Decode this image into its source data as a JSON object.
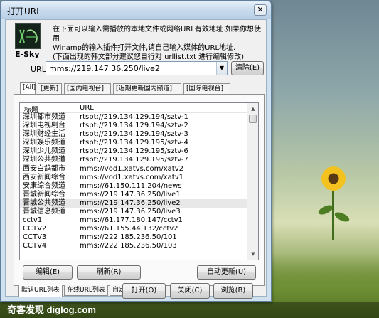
{
  "window": {
    "title": "打开URL",
    "close_glyph": "✕"
  },
  "logo": {
    "label": "E-Sky"
  },
  "intro": {
    "line1": "在下面可以输入需播放的本地文件或网络URL有效地址.如果你想使用",
    "line2": "Winamp的输入插件打开文件,请自己输入媒体的URL地址.",
    "line3": "(下面出现的韩文部分建议您自行对 urllist.txt 进行编辑修改)"
  },
  "url_field": {
    "label": "URL:",
    "value": "mms://219.147.36.250/live2",
    "clear_label": "清除(E)"
  },
  "tabs": [
    "[All]",
    "[更新]",
    "[国内电视台]",
    "[近期更新国内频道]",
    "[国际电视台]"
  ],
  "list": {
    "headers": {
      "title": "标题",
      "url": "URL"
    },
    "rows": [
      {
        "title": "深圳都市频道",
        "url": "rtspt://219.134.129.194/sztv-1"
      },
      {
        "title": "深圳电视剧台",
        "url": "rtspt://219.134.129.194/sztv-2"
      },
      {
        "title": "深圳财经生活",
        "url": "rtspt://219.134.129.194/sztv-3"
      },
      {
        "title": "深圳娱乐频道",
        "url": "rtspt://219.134.129.195/sztv-4"
      },
      {
        "title": "深圳少儿频道",
        "url": "rtspt://219.134.129.195/sztv-6"
      },
      {
        "title": "深圳公共频道",
        "url": "rtspt://219.134.129.195/sztv-7"
      },
      {
        "title": "西安白鸽都市",
        "url": "mms://vod1.xatvs.com/xatv2"
      },
      {
        "title": "西安新闻综合",
        "url": "mms://vod1.xatvs.com/xatv1"
      },
      {
        "title": "安康综合频道",
        "url": "mms://61.150.111.204/news"
      },
      {
        "title": "晋城新闻综合",
        "url": "mms://219.147.36.250/live1"
      },
      {
        "title": "晋城公共频道",
        "url": "mms://219.147.36.250/live2"
      },
      {
        "title": "晋城信息频道",
        "url": "mms://219.147.36.250/live3"
      },
      {
        "title": "cctv1",
        "url": "mms://61.177.180.147/cctv1"
      },
      {
        "title": "CCTV2",
        "url": "mms://61.155.44.132/cctv2"
      },
      {
        "title": "CCTV3",
        "url": "mms://222.185.236.50/101"
      },
      {
        "title": "CCTV4",
        "url": "mms://222.185.236.50/103"
      }
    ]
  },
  "panel_buttons": {
    "edit": "编辑(E)",
    "refresh": "刷新(R)",
    "auto_update": "自动更新(U)"
  },
  "bottom_tabs": [
    "默认URL列表",
    "在线URL列表",
    "自定义URL列表"
  ],
  "footer_buttons": {
    "open": "打开(O)",
    "close": "关闭(C)",
    "browse": "浏览(B)"
  },
  "watermark": "奇客发现 diglog.com",
  "colors": {
    "titlebar": "#c9dcee",
    "selected_row": "#e8e8e8",
    "flower": "#f3c21f"
  }
}
